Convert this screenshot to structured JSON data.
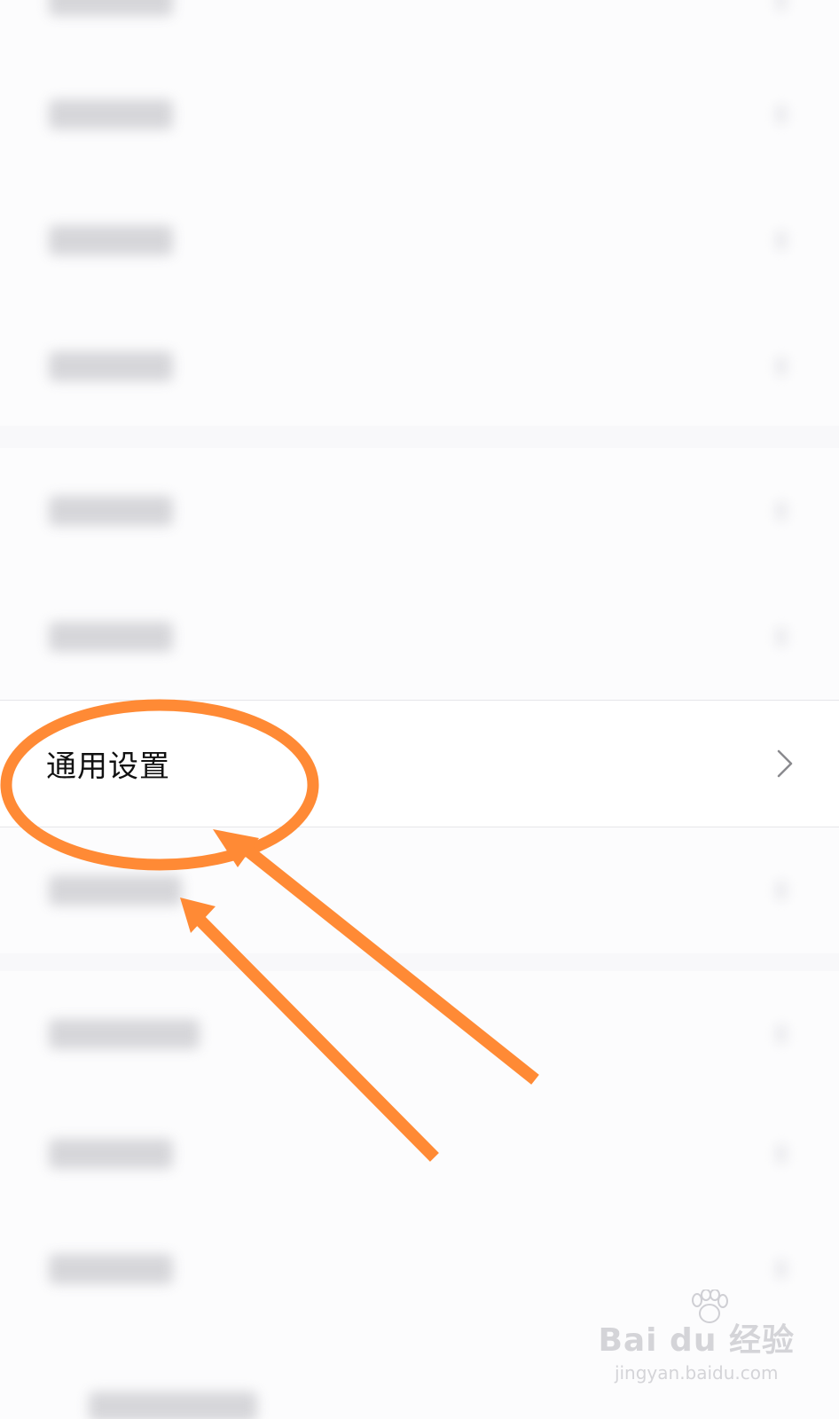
{
  "settings_list": {
    "highlighted_item": {
      "label": "通用设置",
      "icon": "chevron-right-icon"
    }
  },
  "annotation": {
    "color": "#ff8a35",
    "shapes": [
      "circle",
      "arrow",
      "arrow"
    ]
  },
  "watermark": {
    "brand": "Bai du 经验",
    "domain": "jingyan.baidu.com"
  }
}
